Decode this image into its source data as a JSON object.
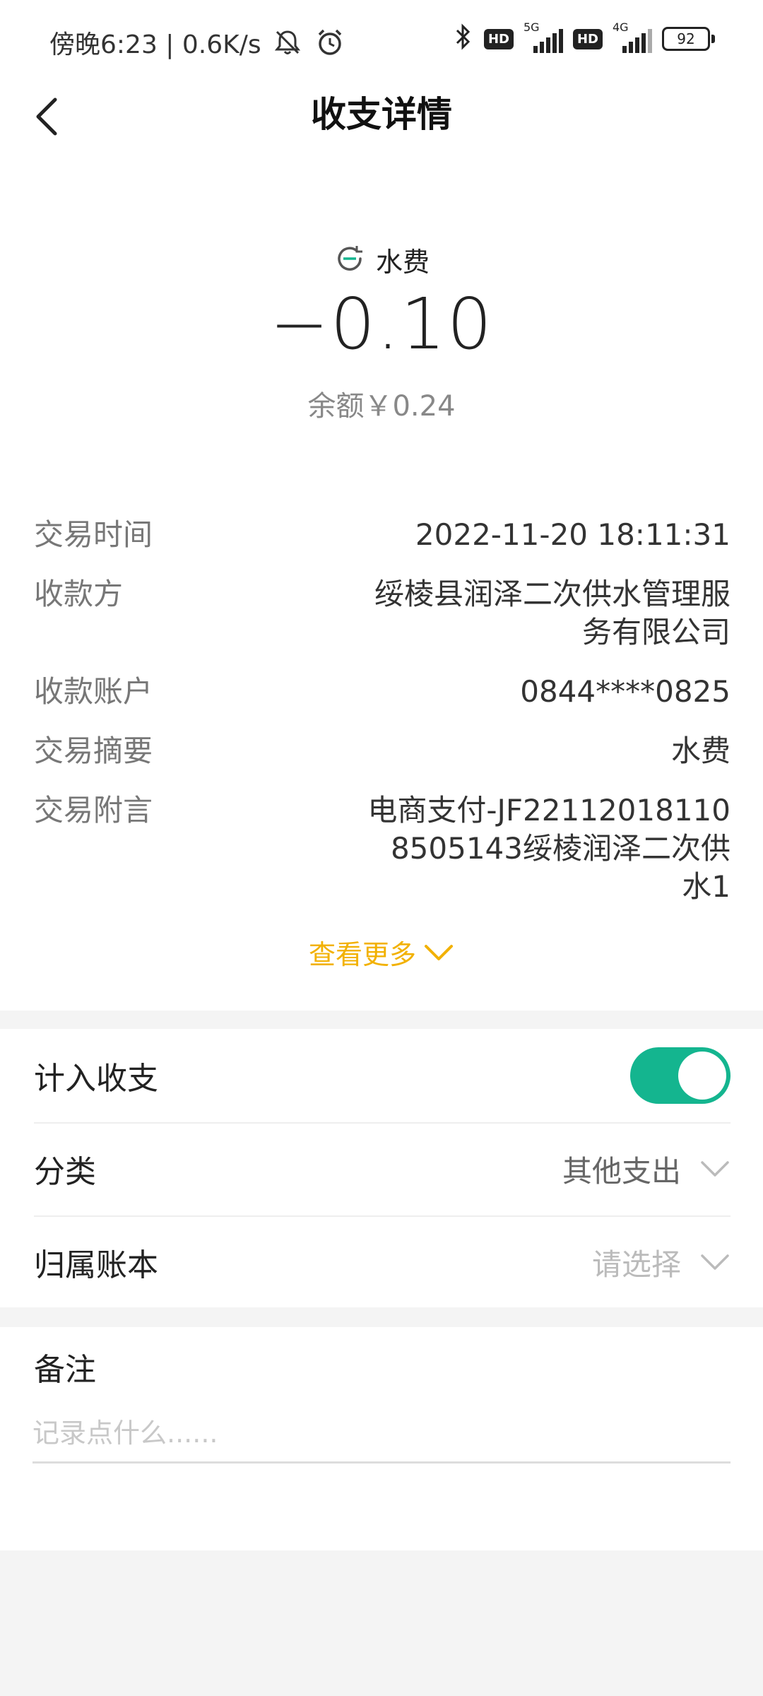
{
  "status_bar": {
    "time_speed": "傍晚6:23 | 0.6K/s",
    "icons": [
      "mute-icon",
      "alarm-icon",
      "bluetooth-icon",
      "hd-icon",
      "signal-icon",
      "hd-icon",
      "signal-icon",
      "battery-icon"
    ],
    "hd_1": "HD",
    "net_1": "5G",
    "hd_2": "HD",
    "net_2": "4G",
    "battery": "92"
  },
  "nav": {
    "title": "收支详情"
  },
  "summary": {
    "merchant": "水费",
    "amount": "−0.10",
    "balance": "余额￥0.24"
  },
  "details": [
    {
      "label": "交易时间",
      "value": "2022-11-20 18:11:31"
    },
    {
      "label": "收款方",
      "value": "绥棱县润泽二次供水管理服务有限公司"
    },
    {
      "label": "收款账户",
      "value": "0844****0825"
    },
    {
      "label": "交易摘要",
      "value": "水费"
    },
    {
      "label": "交易附言",
      "value": "电商支付-JF221120181108505143绥棱润泽二次供水1"
    }
  ],
  "see_more": "查看更多",
  "settings": {
    "include_label": "计入收支",
    "include_on": true,
    "category_label": "分类",
    "category_value": "其他支出",
    "book_label": "归属账本",
    "book_value": "请选择"
  },
  "remark": {
    "label": "备注",
    "placeholder": "记录点什么......"
  },
  "colors": {
    "accent_green": "#14b58f",
    "link_yellow": "#f2b100"
  }
}
